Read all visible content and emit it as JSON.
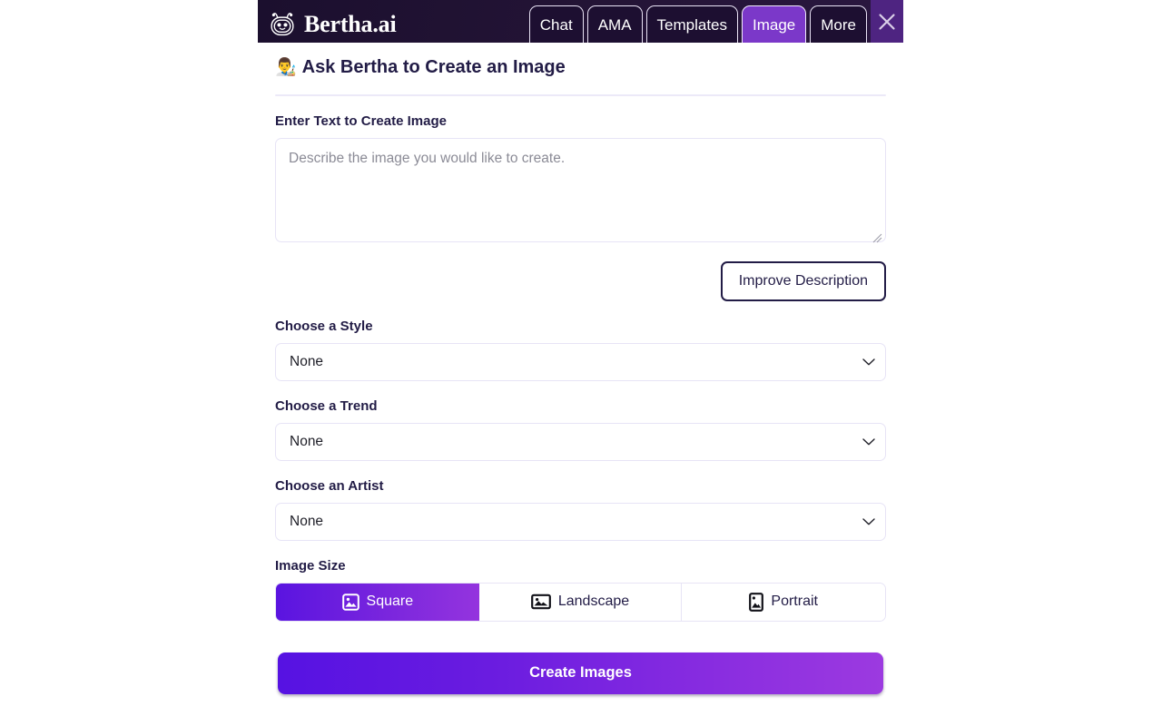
{
  "header": {
    "brand_name": "Bertha.ai",
    "logo_icon": "bot-head-icon",
    "tabs": [
      {
        "label": "Chat",
        "active": false
      },
      {
        "label": "AMA",
        "active": false
      },
      {
        "label": "Templates",
        "active": false
      },
      {
        "label": "Image",
        "active": true
      },
      {
        "label": "More",
        "active": false
      }
    ],
    "close_icon": "close-icon",
    "colors": {
      "bar_background": "#1b0f2e",
      "active_tab": "#7b38c9",
      "close_strip": "#4e2481"
    }
  },
  "main": {
    "title_emoji": "👨‍🎨",
    "title": "Ask Bertha to Create an Image",
    "prompt": {
      "label": "Enter Text to Create Image",
      "placeholder": "Describe the image you would like to create.",
      "value": ""
    },
    "improve_button": "Improve Description",
    "selects": [
      {
        "label": "Choose a Style",
        "value": "None",
        "options": [
          "None"
        ]
      },
      {
        "label": "Choose a Trend",
        "value": "None",
        "options": [
          "None"
        ]
      },
      {
        "label": "Choose an Artist",
        "value": "None",
        "options": [
          "None"
        ]
      }
    ],
    "image_size": {
      "label": "Image Size",
      "options": [
        {
          "label": "Square",
          "icon": "image-square-icon",
          "selected": true
        },
        {
          "label": "Landscape",
          "icon": "image-landscape-icon",
          "selected": false
        },
        {
          "label": "Portrait",
          "icon": "image-portrait-icon",
          "selected": false
        }
      ]
    },
    "create_button": "Create Images",
    "colors": {
      "accent_start": "#5612e2",
      "accent_end": "#9c3ae0",
      "text": "#221c46",
      "border": "#e7e4f6"
    }
  }
}
